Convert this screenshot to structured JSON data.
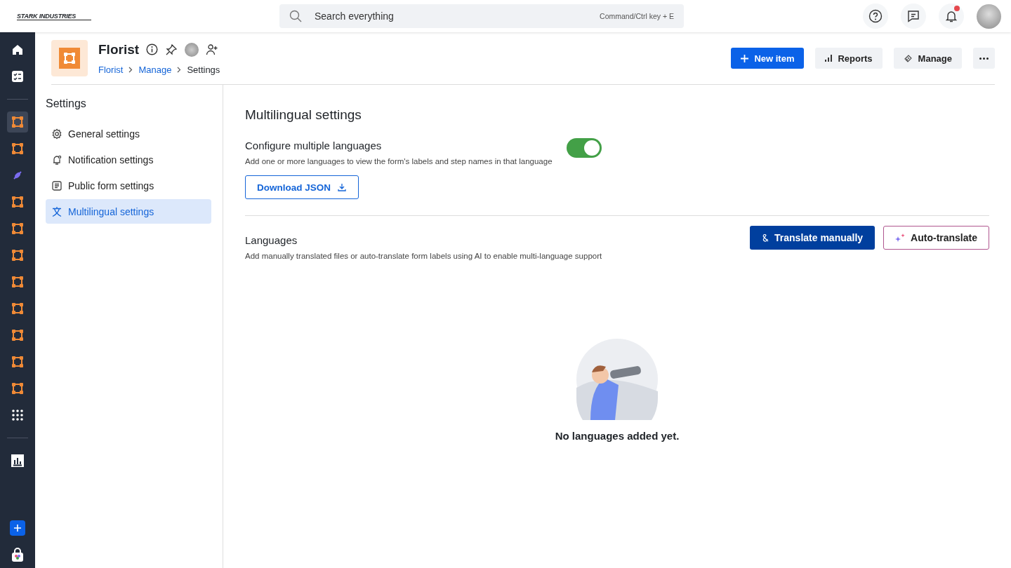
{
  "topbar": {
    "logo": "STARK INDUSTRIES",
    "search": {
      "placeholder": "Search everything",
      "shortcut": "Command/Ctrl key + E"
    },
    "notifications_unread": true
  },
  "rail": [
    {
      "items": [
        {
          "kind": "home",
          "selected": false
        },
        {
          "kind": "tasks",
          "selected": false
        }
      ]
    },
    {
      "items": [
        {
          "kind": "app",
          "selected": true
        },
        {
          "kind": "app",
          "selected": false
        },
        {
          "kind": "plugin",
          "selected": false
        },
        {
          "kind": "app",
          "selected": false
        },
        {
          "kind": "app",
          "selected": false
        },
        {
          "kind": "app",
          "selected": false
        },
        {
          "kind": "app",
          "selected": false
        },
        {
          "kind": "app",
          "selected": false
        },
        {
          "kind": "app",
          "selected": false
        },
        {
          "kind": "app",
          "selected": false
        },
        {
          "kind": "app",
          "selected": false
        },
        {
          "kind": "grid",
          "selected": false
        }
      ]
    },
    {
      "items": [
        {
          "kind": "reports",
          "selected": false
        }
      ]
    },
    {
      "items": [
        {
          "kind": "add",
          "selected": false
        },
        {
          "kind": "store",
          "selected": false
        }
      ]
    }
  ],
  "header": {
    "title": "Florist",
    "breadcrumb": [
      {
        "label": "Florist",
        "link": true
      },
      {
        "label": "Manage",
        "link": true
      },
      {
        "label": "Settings",
        "link": false
      }
    ],
    "actions": [
      {
        "kind": "primary",
        "label": "New item"
      },
      {
        "kind": "reports",
        "label": "Reports"
      },
      {
        "kind": "manage",
        "label": "Manage"
      }
    ]
  },
  "settings_nav": {
    "title": "Settings",
    "items": [
      {
        "kind": "gear",
        "label": "General settings",
        "selected": false
      },
      {
        "kind": "bell",
        "label": "Notification settings",
        "selected": false
      },
      {
        "kind": "form",
        "label": "Public form settings",
        "selected": false
      },
      {
        "kind": "lang",
        "label": "Multilingual settings",
        "selected": true
      }
    ]
  },
  "content": {
    "title": "Multilingual settings",
    "configure": {
      "title": "Configure multiple languages",
      "description": "Add one or more languages to view the form's labels and step names in that language",
      "on": true,
      "button": "Download JSON"
    },
    "languages": {
      "title": "Languages",
      "description": "Add manually translated files or auto-translate form labels using AI to enable multi-language support",
      "buttons": [
        {
          "kind": "primary",
          "label": "Translate manually"
        },
        {
          "kind": "ai",
          "label": "Auto-translate"
        }
      ],
      "empty": "No languages added yet."
    }
  }
}
